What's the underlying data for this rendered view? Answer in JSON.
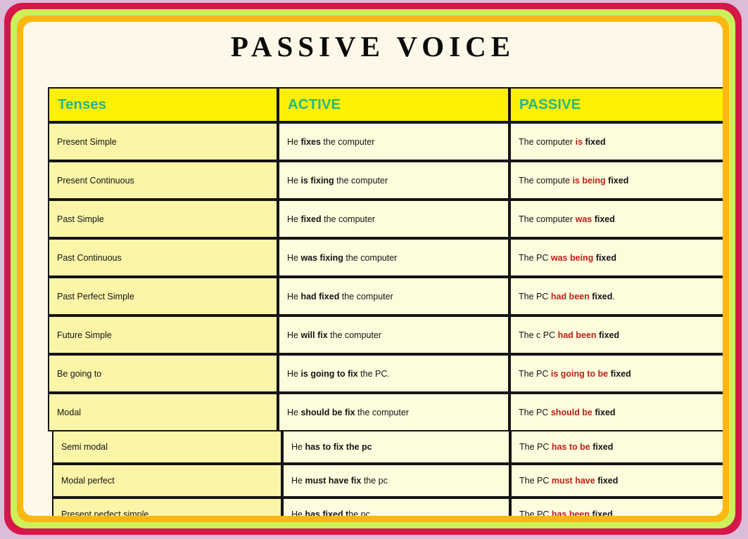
{
  "title": "PASSIVE VOICE",
  "colors": {
    "page_background": "#dbbdd9",
    "frame_red": "#d6174a",
    "frame_green": "#ccf05a",
    "frame_orange": "#fbb712",
    "card_background": "#fdf8e8",
    "header_background": "#fcf003",
    "header_text": "#2ab48a",
    "tense_cell_background": "#fbf5a8",
    "body_cell_background": "#fdfdde",
    "highlight_text": "#c21d16",
    "border": "#141414"
  },
  "table": {
    "headers": {
      "tenses": "Tenses",
      "active": "ACTIVE",
      "passive": "PASSIVE"
    },
    "rows": [
      {
        "tense": "Present Simple",
        "active": [
          {
            "t": "He ",
            "s": "plain"
          },
          {
            "t": "fixes",
            "s": "bold"
          },
          {
            "t": " the computer",
            "s": "plain"
          }
        ],
        "passive": [
          {
            "t": "The computer ",
            "s": "plain"
          },
          {
            "t": "is",
            "s": "highlight"
          },
          {
            "t": " ",
            "s": "plain"
          },
          {
            "t": "fixed",
            "s": "bold"
          }
        ]
      },
      {
        "tense": "Present Continuous",
        "active": [
          {
            "t": "He ",
            "s": "plain"
          },
          {
            "t": "is fixing",
            "s": "bold"
          },
          {
            "t": " the computer",
            "s": "plain"
          }
        ],
        "passive": [
          {
            "t": "The compute ",
            "s": "plain"
          },
          {
            "t": "is being",
            "s": "highlight"
          },
          {
            "t": " ",
            "s": "plain"
          },
          {
            "t": "fixed",
            "s": "bold"
          }
        ]
      },
      {
        "tense": "Past Simple",
        "active": [
          {
            "t": "He ",
            "s": "plain"
          },
          {
            "t": "fixed",
            "s": "bold"
          },
          {
            "t": " the computer",
            "s": "plain"
          }
        ],
        "passive": [
          {
            "t": "The computer ",
            "s": "plain"
          },
          {
            "t": "was",
            "s": "highlight"
          },
          {
            "t": " ",
            "s": "plain"
          },
          {
            "t": "fixed",
            "s": "bold"
          }
        ]
      },
      {
        "tense": "Past Continuous",
        "active": [
          {
            "t": "He ",
            "s": "plain"
          },
          {
            "t": "was fixing",
            "s": "bold"
          },
          {
            "t": " the computer",
            "s": "plain"
          }
        ],
        "passive": [
          {
            "t": "The PC ",
            "s": "plain"
          },
          {
            "t": "was being",
            "s": "highlight"
          },
          {
            "t": " ",
            "s": "plain"
          },
          {
            "t": "fixed",
            "s": "bold"
          }
        ]
      },
      {
        "tense": "Past Perfect Simple",
        "active": [
          {
            "t": "He ",
            "s": "plain"
          },
          {
            "t": "had fixed",
            "s": "bold"
          },
          {
            "t": " the computer",
            "s": "plain"
          }
        ],
        "passive": [
          {
            "t": "The PC ",
            "s": "plain"
          },
          {
            "t": "had been",
            "s": "highlight"
          },
          {
            "t": " ",
            "s": "plain"
          },
          {
            "t": "fixed",
            "s": "bold"
          },
          {
            "t": ".",
            "s": "plain"
          }
        ]
      },
      {
        "tense": "Future Simple",
        "active": [
          {
            "t": "He ",
            "s": "plain"
          },
          {
            "t": "will fix",
            "s": "bold"
          },
          {
            "t": " the computer",
            "s": "plain"
          }
        ],
        "passive": [
          {
            "t": "The c PC ",
            "s": "plain"
          },
          {
            "t": "had been",
            "s": "highlight"
          },
          {
            "t": " ",
            "s": "plain"
          },
          {
            "t": "fixed",
            "s": "bold"
          }
        ]
      },
      {
        "tense": "Be going to",
        "active": [
          {
            "t": "He ",
            "s": "plain"
          },
          {
            "t": "is going to fix",
            "s": "bold"
          },
          {
            "t": " the PC.",
            "s": "plain"
          }
        ],
        "passive": [
          {
            "t": "The PC ",
            "s": "plain"
          },
          {
            "t": "is going to be",
            "s": "highlight"
          },
          {
            "t": " ",
            "s": "plain"
          },
          {
            "t": "fixed",
            "s": "bold"
          }
        ]
      },
      {
        "tense": "Modal",
        "active": [
          {
            "t": "He ",
            "s": "plain"
          },
          {
            "t": "should be fix",
            "s": "bold"
          },
          {
            "t": " the computer",
            "s": "plain"
          }
        ],
        "passive": [
          {
            "t": "The PC ",
            "s": "plain"
          },
          {
            "t": "should  be",
            "s": "highlight"
          },
          {
            "t": " ",
            "s": "plain"
          },
          {
            "t": "fixed",
            "s": "bold"
          }
        ]
      }
    ],
    "extra_rows": [
      {
        "tense": "Semi modal",
        "active": [
          {
            "t": "He ",
            "s": "plain"
          },
          {
            "t": "has to fix the pc",
            "s": "bold"
          }
        ],
        "passive": [
          {
            "t": "The PC  ",
            "s": "plain"
          },
          {
            "t": "has to be",
            "s": "highlight"
          },
          {
            "t": " ",
            "s": "plain"
          },
          {
            "t": "fixed",
            "s": "bold"
          }
        ]
      },
      {
        "tense": "Modal perfect",
        "active": [
          {
            "t": "He  ",
            "s": "plain"
          },
          {
            "t": "must have fix",
            "s": "bold"
          },
          {
            "t": " the pc",
            "s": "plain"
          }
        ],
        "passive": [
          {
            "t": "The PC ",
            "s": "plain"
          },
          {
            "t": "must have",
            "s": "highlight"
          },
          {
            "t": " ",
            "s": "plain"
          },
          {
            "t": "fixed",
            "s": "bold"
          }
        ]
      },
      {
        "tense": "Present perfect simple",
        "active": [
          {
            "t": "He ",
            "s": "plain"
          },
          {
            "t": "has fixed t",
            "s": "bold"
          },
          {
            "t": "he pc",
            "s": "plain"
          }
        ],
        "passive": [
          {
            "t": "The PC ",
            "s": "plain"
          },
          {
            "t": "has been",
            "s": "highlight"
          },
          {
            "t": " ",
            "s": "plain"
          },
          {
            "t": "fixed",
            "s": "bold"
          }
        ]
      }
    ]
  }
}
